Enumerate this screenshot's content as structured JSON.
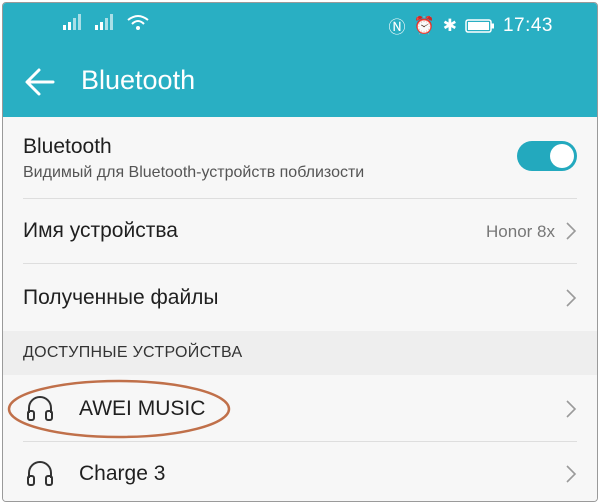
{
  "status_bar": {
    "time": "17:43",
    "icons": [
      "signal-icon",
      "signal-icon",
      "wifi-icon",
      "nfc-icon",
      "alarm-icon",
      "bluetooth-icon",
      "battery-icon"
    ]
  },
  "toolbar": {
    "back_icon": "arrow-left-icon",
    "title": "Bluetooth"
  },
  "bluetooth_toggle": {
    "label": "Bluetooth",
    "description": "Видимый для Bluetooth-устройств поблизости",
    "enabled": true,
    "accent_color": "#29afc3"
  },
  "device_name": {
    "label": "Имя устройства",
    "value": "Honor 8x"
  },
  "received_files": {
    "label": "Полученные файлы"
  },
  "available_devices": {
    "section_title": "ДОСТУПНЫЕ УСТРОЙСТВА",
    "items": [
      {
        "label": "AWEI MUSIC",
        "icon": "headset-icon",
        "highlighted": true
      },
      {
        "label": "Charge 3",
        "icon": "headset-icon",
        "highlighted": false
      }
    ]
  },
  "highlight_color": "#c0704a"
}
